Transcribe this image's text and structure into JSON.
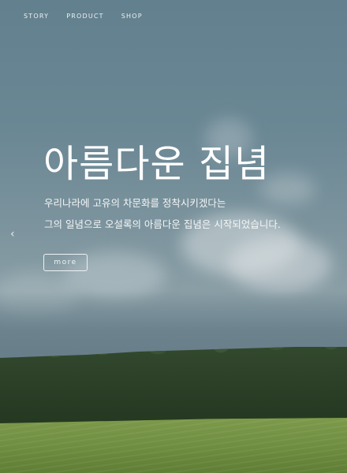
{
  "nav": {
    "items": [
      {
        "label": "STORY"
      },
      {
        "label": "PRODUCT"
      },
      {
        "label": "SHOP"
      }
    ]
  },
  "hero": {
    "title": "아름다운 집념",
    "lines": [
      "우리나라에 고유의 차문화를 정착시키겠다는",
      "그의 일념으로 오설록의 아름다운 집념은 시작되었습니다."
    ],
    "more_label": "more",
    "prev_arrow": "‹",
    "background": "sky-clouds-forest-tea-field"
  },
  "colors": {
    "text": "#ffffff",
    "sky": "#62808e",
    "forest": "#2c4128",
    "field": "#7d9a4b"
  }
}
